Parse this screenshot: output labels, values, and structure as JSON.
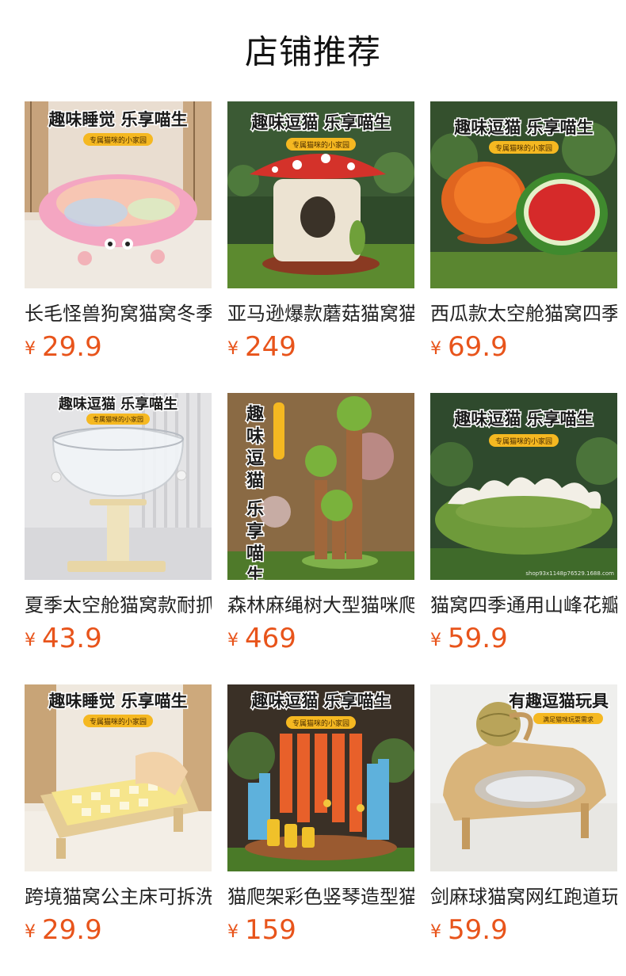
{
  "page": {
    "title": "店铺推荐"
  },
  "colors": {
    "price": "#e8541b",
    "title": "#111111",
    "name": "#222222"
  },
  "products": [
    {
      "name": "长毛怪兽狗窝猫窝冬季",
      "currency": "¥",
      "price": "29.9",
      "banner": "趣味睡觉 乐享喵生",
      "tag": "专属猫咪的小家园",
      "image": "pink-fluffy-cat-bed"
    },
    {
      "name": "亚马逊爆款蘑菇猫窝猫",
      "currency": "¥",
      "price": "249",
      "banner": "趣味逗猫 乐享喵生",
      "tag": "专属猫咪的小家园",
      "image": "mushroom-cat-house"
    },
    {
      "name": "西瓜款太空舱猫窝四季",
      "currency": "¥",
      "price": "69.9",
      "banner": "趣味逗猫 乐享喵生",
      "tag": "专属猫咪的小家园",
      "image": "watermelon-cat-pod"
    },
    {
      "name": "夏季太空舱猫窝款耐抓",
      "currency": "¥",
      "price": "43.9",
      "banner": "趣味逗猫 乐享喵生",
      "tag": "专属猫咪的小家园",
      "image": "glass-bowl-cat-bed"
    },
    {
      "name": "森林麻绳树大型猫咪爬",
      "currency": "¥",
      "price": "469",
      "banner": "趣味逗猫 乐享喵生",
      "tag": "专属猫咪的小家园",
      "image": "forest-sisal-cat-tree"
    },
    {
      "name": "猫窝四季通用山峰花瓣",
      "currency": "¥",
      "price": "59.9",
      "banner": "趣味逗猫 乐享喵生",
      "tag": "专属猫咪的小家园",
      "watermark": "shop93x1148p76529.1688.com",
      "image": "mountain-petal-cat-bed"
    },
    {
      "name": "跨境猫窝公主床可拆洗",
      "currency": "¥",
      "price": "29.9",
      "banner": "趣味睡觉 乐享喵生",
      "tag": "专属猫咪的小家园",
      "image": "wooden-princess-cat-bed"
    },
    {
      "name": "猫爬架彩色竖琴造型猫",
      "currency": "¥",
      "price": "159",
      "banner": "趣味逗猫 乐享喵生",
      "tag": "专属猫咪的小家园",
      "image": "colorful-harp-cat-scratcher"
    },
    {
      "name": "剑麻球猫窝网红跑道玩",
      "currency": "¥",
      "price": "59.9",
      "banner": "有趣逗猫玩具",
      "tag": "满足猫咪玩耍需求",
      "image": "sisal-ball-track-cat-bed"
    }
  ]
}
